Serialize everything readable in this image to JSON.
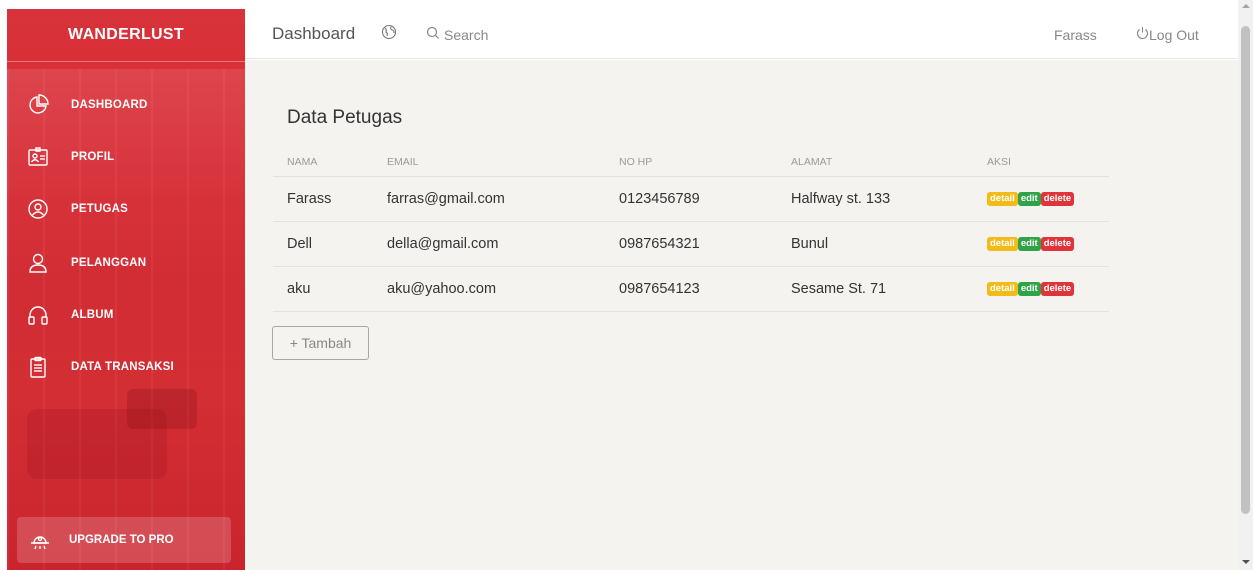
{
  "brand": {
    "part1": "WANDER",
    "part2": "LUST"
  },
  "sidebar": {
    "items": [
      {
        "label": "DASHBOARD",
        "icon": "pie-chart-icon"
      },
      {
        "label": "PROFIL",
        "icon": "id-card-icon"
      },
      {
        "label": "PETUGAS",
        "icon": "user-circle-icon"
      },
      {
        "label": "PELANGGAN",
        "icon": "user-icon"
      },
      {
        "label": "ALBUM",
        "icon": "headphones-icon"
      },
      {
        "label": "DATA TRANSAKSI",
        "icon": "clipboard-icon"
      }
    ],
    "upgrade": {
      "label": "UPGRADE TO PRO",
      "icon": "spaceship-icon"
    }
  },
  "topbar": {
    "title": "Dashboard",
    "globe_icon": "globe-icon",
    "search_label": "Search",
    "user": "Farass",
    "logout": "Log Out"
  },
  "main": {
    "title": "Data Petugas",
    "columns": [
      "NAMA",
      "EMAIL",
      "NO HP",
      "ALAMAT",
      "AKSI"
    ],
    "rows": [
      {
        "nama": "Farass",
        "email": "farras@gmail.com",
        "hp": "0123456789",
        "alamat": "Halfway st. 133"
      },
      {
        "nama": "Dell",
        "email": "della@gmail.com",
        "hp": "0987654321",
        "alamat": "Bunul"
      },
      {
        "nama": "aku",
        "email": "aku@yahoo.com",
        "hp": "0987654123",
        "alamat": "Sesame St. 71"
      }
    ],
    "actions": {
      "detail": "detail",
      "edit": "edit",
      "delete": "delete"
    },
    "add_button": "+ Tambah"
  },
  "colors": {
    "sidebar_red": "#dd2a33",
    "detail": "#f3bb17",
    "edit": "#2fa347",
    "delete": "#e0343b",
    "content_bg": "#f4f3ef"
  }
}
